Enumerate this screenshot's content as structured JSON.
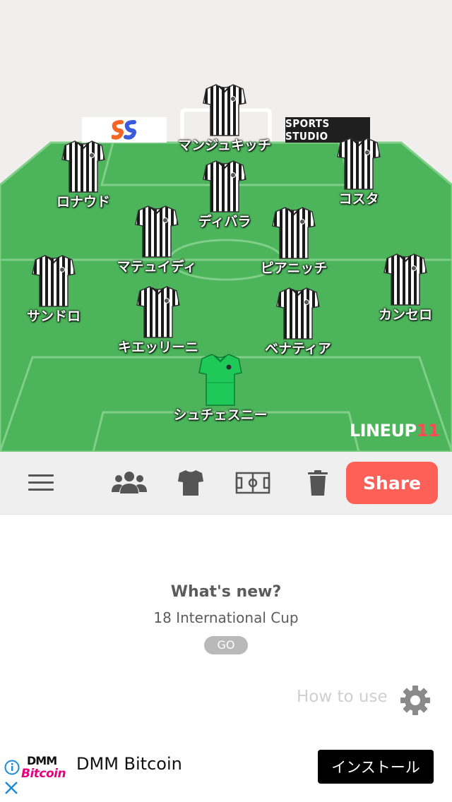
{
  "sponsors": {
    "right_label": "SPORTS STUDIO"
  },
  "players": [
    {
      "name": "マンジュキッチ",
      "kit": "outfield"
    },
    {
      "name": "ロナウド",
      "kit": "outfield"
    },
    {
      "name": "ディバラ",
      "kit": "outfield"
    },
    {
      "name": "コスタ",
      "kit": "outfield"
    },
    {
      "name": "マテュイディ",
      "kit": "outfield"
    },
    {
      "name": "ピアニッチ",
      "kit": "outfield"
    },
    {
      "name": "サンドロ",
      "kit": "outfield"
    },
    {
      "name": "カンセロ",
      "kit": "outfield"
    },
    {
      "name": "キエッリーニ",
      "kit": "outfield"
    },
    {
      "name": "ベナティア",
      "kit": "outfield"
    },
    {
      "name": "シュチェスニー",
      "kit": "goalkeeper"
    }
  ],
  "watermark": {
    "main": "LINEUP",
    "accent": "11"
  },
  "toolbar": {
    "icons": [
      "menu-icon",
      "team-icon",
      "shirt-icon",
      "field-icon",
      "trash-icon"
    ],
    "share_label": "Share"
  },
  "whats_new": {
    "title": "What's new?",
    "subtitle": "18 International Cup",
    "go_label": "GO"
  },
  "how_to_use": "How to use",
  "ad": {
    "logo_top": "DMM",
    "logo_bottom": "Bitcoin",
    "title": "DMM Bitcoin",
    "install_label": "インストール"
  },
  "colors": {
    "pitch": "#4cb45b",
    "pitch_lines": "#7fcf88",
    "share": "#fc6057",
    "goalkeeper_kit": "#1ec95a"
  }
}
